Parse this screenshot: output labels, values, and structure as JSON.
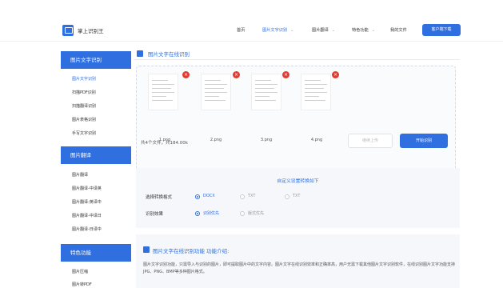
{
  "header": {
    "brand": "掌上识别王",
    "nav": [
      {
        "label": "首页",
        "dropdown": false,
        "active": false
      },
      {
        "label": "图片文字识别",
        "dropdown": true,
        "active": true
      },
      {
        "label": "图片翻译",
        "dropdown": true,
        "active": false
      },
      {
        "label": "特色功能",
        "dropdown": true,
        "active": false
      },
      {
        "label": "我的文件",
        "dropdown": false,
        "active": false
      }
    ],
    "download_button": "客户端下载"
  },
  "sidebar": {
    "sections": [
      {
        "title": "图片文字识别",
        "items": [
          {
            "label": "图片文字识别",
            "active": true
          },
          {
            "label": "扫描PDF识别",
            "active": false
          },
          {
            "label": "扫描翻译识别",
            "active": false
          },
          {
            "label": "图片表格识别",
            "active": false
          },
          {
            "label": "手写文字识别",
            "active": false
          }
        ]
      },
      {
        "title": "图片翻译",
        "items": [
          {
            "label": "图片翻译",
            "active": false
          },
          {
            "label": "图片翻译-中译英",
            "active": false
          },
          {
            "label": "图片翻译-英译中",
            "active": false
          },
          {
            "label": "图片翻译-中译日",
            "active": false
          },
          {
            "label": "图片翻译-日译中",
            "active": false
          }
        ]
      },
      {
        "title": "特色功能",
        "items": [
          {
            "label": "图片压缩",
            "active": false
          },
          {
            "label": "图片转PDF",
            "active": false
          }
        ]
      }
    ]
  },
  "main": {
    "section_title": "图片文字在线识别",
    "files": [
      {
        "name": "1.png"
      },
      {
        "name": "2.png"
      },
      {
        "name": "3.png"
      },
      {
        "name": "4.png"
      }
    ],
    "count_text": "共4个文件，共184.00k",
    "continue_button": "继续上传",
    "start_button": "开始识别",
    "settings": {
      "title": "自定义设置转换如下",
      "format_label": "选择转换格式",
      "format_options": [
        {
          "label": "DOCX",
          "selected": true
        },
        {
          "label": "TXT",
          "selected": false
        },
        {
          "label": "TXT",
          "selected": false
        }
      ],
      "effect_label": "识别效果",
      "effect_options": [
        {
          "label": "识别优先",
          "selected": true
        },
        {
          "label": "版式优先",
          "selected": false
        }
      ]
    },
    "intro": {
      "title": "图片文字在线识别功能 功能介绍:",
      "text": "图片文字识别功能，只需导入与识别的图片，即可提取图片中的文字内容。图片文字在线识别效率和正确率高，用户无需下载其他图片文字识别软件，在线识别图片文字功能支持JPG、PNG、BMP等多种图片格式。"
    },
    "colors": {
      "accent": "#2f6fe0",
      "delete": "#e23b30"
    }
  }
}
